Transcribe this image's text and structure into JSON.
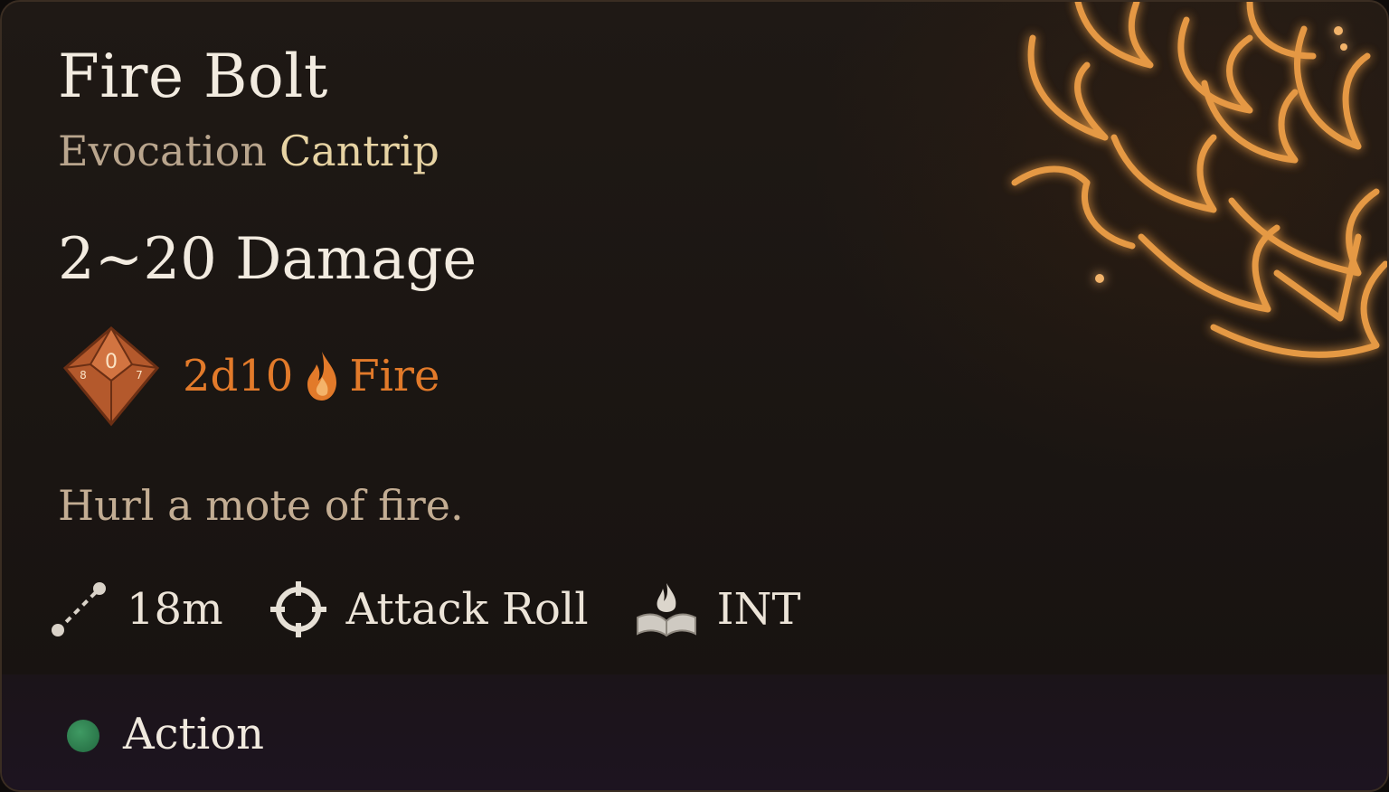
{
  "spell": {
    "name": "Fire Bolt",
    "school": "Evocation",
    "level": "Cantrip",
    "damage": "2~20 Damage",
    "dice": "2d10",
    "damage_type": "Fire",
    "description": "Hurl a mote of fire.",
    "range": "18m",
    "attack": "Attack Roll",
    "ability": "INT",
    "cost": "Action"
  },
  "icons": {
    "dice": "d10-die-icon",
    "damage_type": "fire-icon",
    "range": "range-icon",
    "attack": "crosshair-icon",
    "ability": "spellbook-icon",
    "cost": "action-dot-icon",
    "art": "fire-bolt-flames"
  },
  "colors": {
    "damage_text": "#e27a2a",
    "action_dot": "#2f8a52",
    "cantrip": "#e7d3a3",
    "school": "#b9a58d"
  }
}
